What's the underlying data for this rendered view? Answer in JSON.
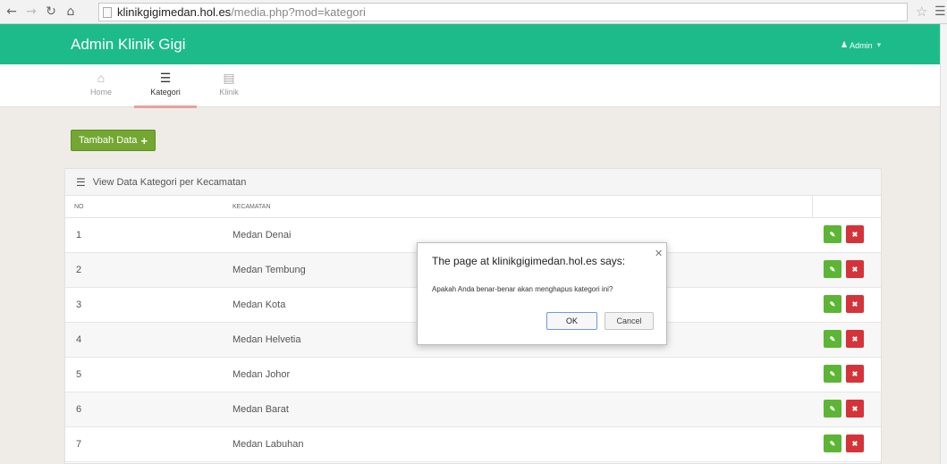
{
  "browser": {
    "url_host": "klinikgigimedan.hol.es",
    "url_path": "/media.php?mod=kategori"
  },
  "header": {
    "brand": "Admin Klinik Gigi",
    "user_menu": "Admin",
    "accent_color": "#1dbb8a"
  },
  "subnav": {
    "items": [
      {
        "label": "Home",
        "icon": "home-icon"
      },
      {
        "label": "Kategori",
        "icon": "list-icon",
        "active": true
      },
      {
        "label": "Klinik",
        "icon": "monitor-icon"
      }
    ]
  },
  "toolbar": {
    "add_label": "Tambah Data"
  },
  "panel": {
    "title": "View Data Kategori per Kecamatan",
    "columns": [
      "NO",
      "KECAMATAN"
    ],
    "rows": [
      {
        "no": "1",
        "name": "Medan Denai"
      },
      {
        "no": "2",
        "name": "Medan Tembung"
      },
      {
        "no": "3",
        "name": "Medan Kota"
      },
      {
        "no": "4",
        "name": "Medan Helvetia"
      },
      {
        "no": "5",
        "name": "Medan Johor"
      },
      {
        "no": "6",
        "name": "Medan Barat"
      },
      {
        "no": "7",
        "name": "Medan Labuhan"
      }
    ]
  },
  "dialog": {
    "title": "The page at klinikgigimedan.hol.es says:",
    "message": "Apakah Anda benar-benar akan menghapus kategori ini?",
    "ok": "OK",
    "cancel": "Cancel"
  }
}
